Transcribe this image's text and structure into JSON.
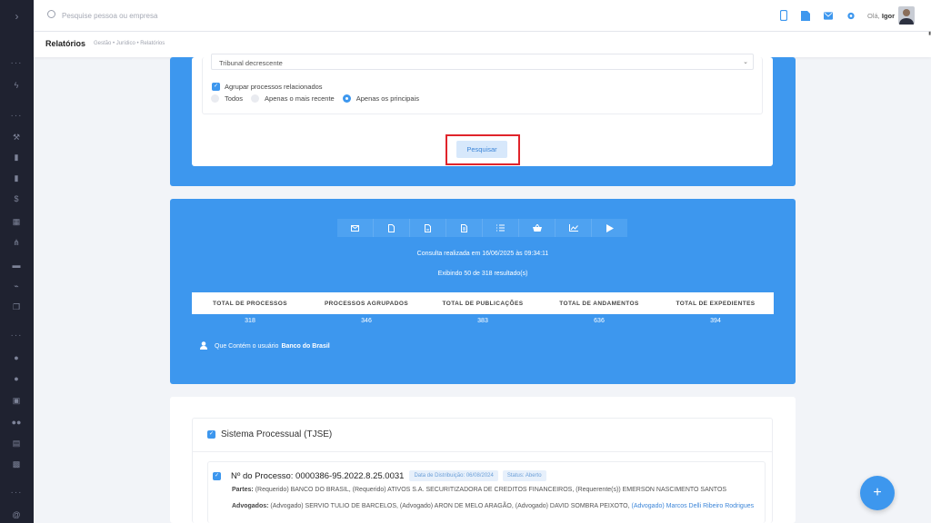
{
  "topbar": {
    "search_placeholder": "Pesquise pessoa ou empresa",
    "greeting_prefix": "Olá,",
    "user_name": "Igor"
  },
  "breadcrumb": {
    "title": "Relatórios",
    "path": "Gestão • Jurídico • Relatórios"
  },
  "filters": {
    "order_select": "Tribunal decrescente",
    "group_label": "Agrupar processos relacionados",
    "radio_options": [
      "Todos",
      "Apenas o mais recente",
      "Apenas os principais"
    ],
    "radio_selected": "Apenas os principais",
    "search_button": "Pesquisar"
  },
  "results": {
    "consulta_text": "Consulta realizada em 16/06/2025 às 09:34:11",
    "exibindo_text": "Exibindo 50 de 318 resultado(s)",
    "stats": [
      {
        "label": "TOTAL DE PROCESSOS",
        "value": "318"
      },
      {
        "label": "PROCESSOS AGRUPADOS",
        "value": "346"
      },
      {
        "label": "TOTAL DE PUBLICAÇÕES",
        "value": "383"
      },
      {
        "label": "TOTAL DE ANDAMENTOS",
        "value": "636"
      },
      {
        "label": "TOTAL DE EXPEDIENTES",
        "value": "394"
      }
    ],
    "user_filter_prefix": "Que Contém o usuário",
    "user_filter_name": "Banco do Brasil",
    "toolbar_icons": [
      "mail-icon",
      "file-icon",
      "pdf-icon",
      "doc-icon",
      "list-icon",
      "basket-icon",
      "chart-icon",
      "play-icon"
    ]
  },
  "system": {
    "title": "Sistema Processual (TJSE)",
    "process": {
      "number_label": "Nº do Processo: 0000386-95.2022.8.25.0031",
      "distribution_badge": "Data de Distribuição: 06/08/2024",
      "status_badge": "Status: Aberto",
      "parts_label": "Partes:",
      "parts_text": "(Requerido) BANCO DO BRASIL, (Requerido) ATIVOS S.A. SECURITIZADORA DE CREDITOS FINANCEIROS, (Requerente(s)) EMERSON NASCIMENTO SANTOS",
      "advs_label": "Advogados:",
      "advs_text": "(Advogado) SERVIO TULIO DE BARCELOS, (Advogado) ARON DE MELO ARAGÃO, (Advogado) DAVID SOMBRA PEIXOTO,",
      "advs_link": "(Advogado) Marcos Delli Ribeiro Rodrigues"
    }
  },
  "fab_label": "+",
  "colors": {
    "primary": "#3d97ee",
    "sidebar": "#1f2230",
    "highlight": "#e0242b"
  }
}
